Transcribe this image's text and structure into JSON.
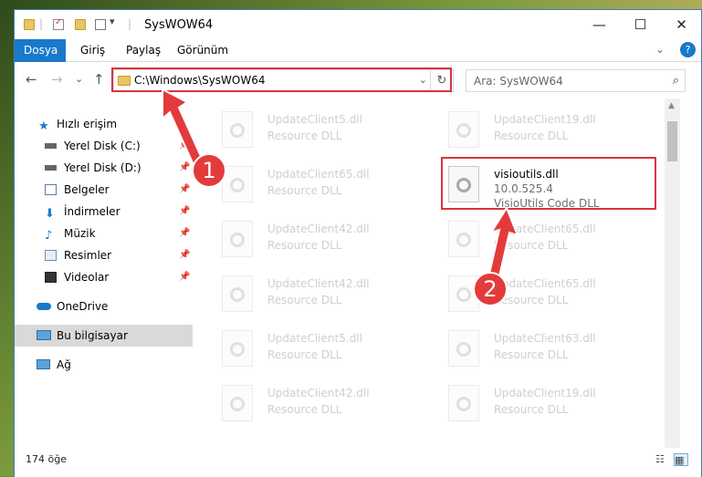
{
  "window": {
    "title": "SysWOW64",
    "quick_access_sep": "|",
    "quick_access_more": "▾",
    "controls": {
      "minimize": "—",
      "maximize": "☐",
      "close": "✕"
    }
  },
  "ribbon": {
    "tabs": [
      "Dosya",
      "Giriş",
      "Paylaş",
      "Görünüm"
    ],
    "collapse_glyph": "⌄",
    "help_glyph": "?"
  },
  "nav": {
    "back_glyph": "←",
    "forward_glyph": "→",
    "recent_glyph": "⌄",
    "up_glyph": "↑",
    "address": "C:\\Windows\\SysWOW64",
    "address_drop_glyph": "⌄",
    "refresh_glyph": "↻",
    "search_placeholder": "Ara: SysWOW64",
    "search_glyph": "⌕"
  },
  "sidebar": {
    "items": [
      {
        "label": "Hızlı erişim",
        "icon": "star-icon",
        "pinned": false
      },
      {
        "label": "Yerel Disk (C:)",
        "icon": "drive-icon",
        "pinned": true
      },
      {
        "label": "Yerel Disk (D:)",
        "icon": "drive-icon",
        "pinned": true
      },
      {
        "label": "Belgeler",
        "icon": "documents-icon",
        "pinned": true
      },
      {
        "label": "İndirmeler",
        "icon": "download-icon",
        "pinned": true
      },
      {
        "label": "Müzik",
        "icon": "music-icon",
        "pinned": true
      },
      {
        "label": "Resimler",
        "icon": "pictures-icon",
        "pinned": true
      },
      {
        "label": "Videolar",
        "icon": "videos-icon",
        "pinned": true
      },
      {
        "label": "OneDrive",
        "icon": "cloud-icon",
        "pinned": false
      },
      {
        "label": "Bu bilgisayar",
        "icon": "computer-icon",
        "pinned": false,
        "selected": true
      },
      {
        "label": "Ağ",
        "icon": "network-icon",
        "pinned": false
      }
    ],
    "pin_glyph": "📌"
  },
  "files": {
    "left": [
      {
        "name": "UpdateClient5.dll",
        "type": "Resource DLL"
      },
      {
        "name": "UpdateClient65.dll",
        "type": "Resource DLL"
      },
      {
        "name": "UpdateClient42.dll",
        "type": "Resource DLL"
      },
      {
        "name": "UpdateClient42.dll",
        "type": "Resource DLL"
      },
      {
        "name": "UpdateClient5.dll",
        "type": "Resource DLL"
      },
      {
        "name": "UpdateClient42.dll",
        "type": "Resource DLL"
      }
    ],
    "right": [
      {
        "name": "UpdateClient19.dll",
        "type": "Resource DLL"
      },
      {
        "name": "visioutils.dll",
        "version": "10.0.525.4",
        "type": "VisioUtils Code DLL",
        "highlighted": true
      },
      {
        "name": "UpdateClient65.dll",
        "type": "Resource DLL"
      },
      {
        "name": "UpdateClient65.dll",
        "type": "Resource DLL"
      },
      {
        "name": "UpdateClient63.dll",
        "type": "Resource DLL"
      },
      {
        "name": "UpdateClient19.dll",
        "type": "Resource DLL"
      }
    ]
  },
  "status": {
    "item_count": "174 öğe"
  },
  "annotations": {
    "badge1": "1",
    "badge2": "2",
    "color": "#d9343e"
  }
}
